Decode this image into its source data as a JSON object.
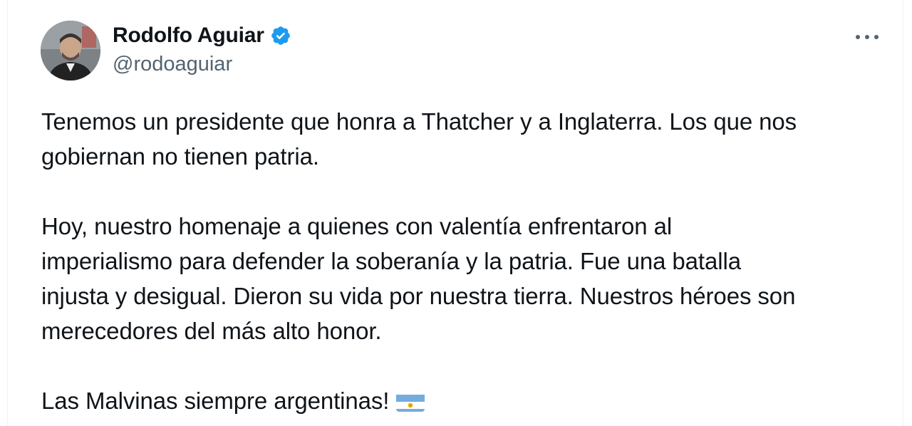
{
  "author": {
    "display_name": "Rodolfo Aguiar",
    "handle": "@rodoaguiar",
    "verified": true,
    "verified_icon": "verified-badge-icon",
    "avatar_icon": "user-avatar"
  },
  "actions": {
    "more_icon": "more-options-icon"
  },
  "tweet": {
    "paragraphs": [
      "Tenemos un presidente que honra a Thatcher y a Inglaterra. Los que nos\ngobiernan no tienen patria.",
      "Hoy, nuestro homenaje a quienes con valentía enfrentaron al\nimperialismo para defender la soberanía y la patria. Fue una batalla\ninjusta y desigual. Dieron su vida por nuestra tierra. Nuestros héroes son\nmerecedores del más alto honor.",
      "Las Malvinas siempre argentinas!"
    ],
    "emoji": "argentina-flag-emoji"
  },
  "colors": {
    "text_primary": "#0f1419",
    "text_secondary": "#536471",
    "verified_blue": "#1d9bf0",
    "flag_sky_blue": "#74acdf",
    "flag_sun": "#f6b40e"
  }
}
